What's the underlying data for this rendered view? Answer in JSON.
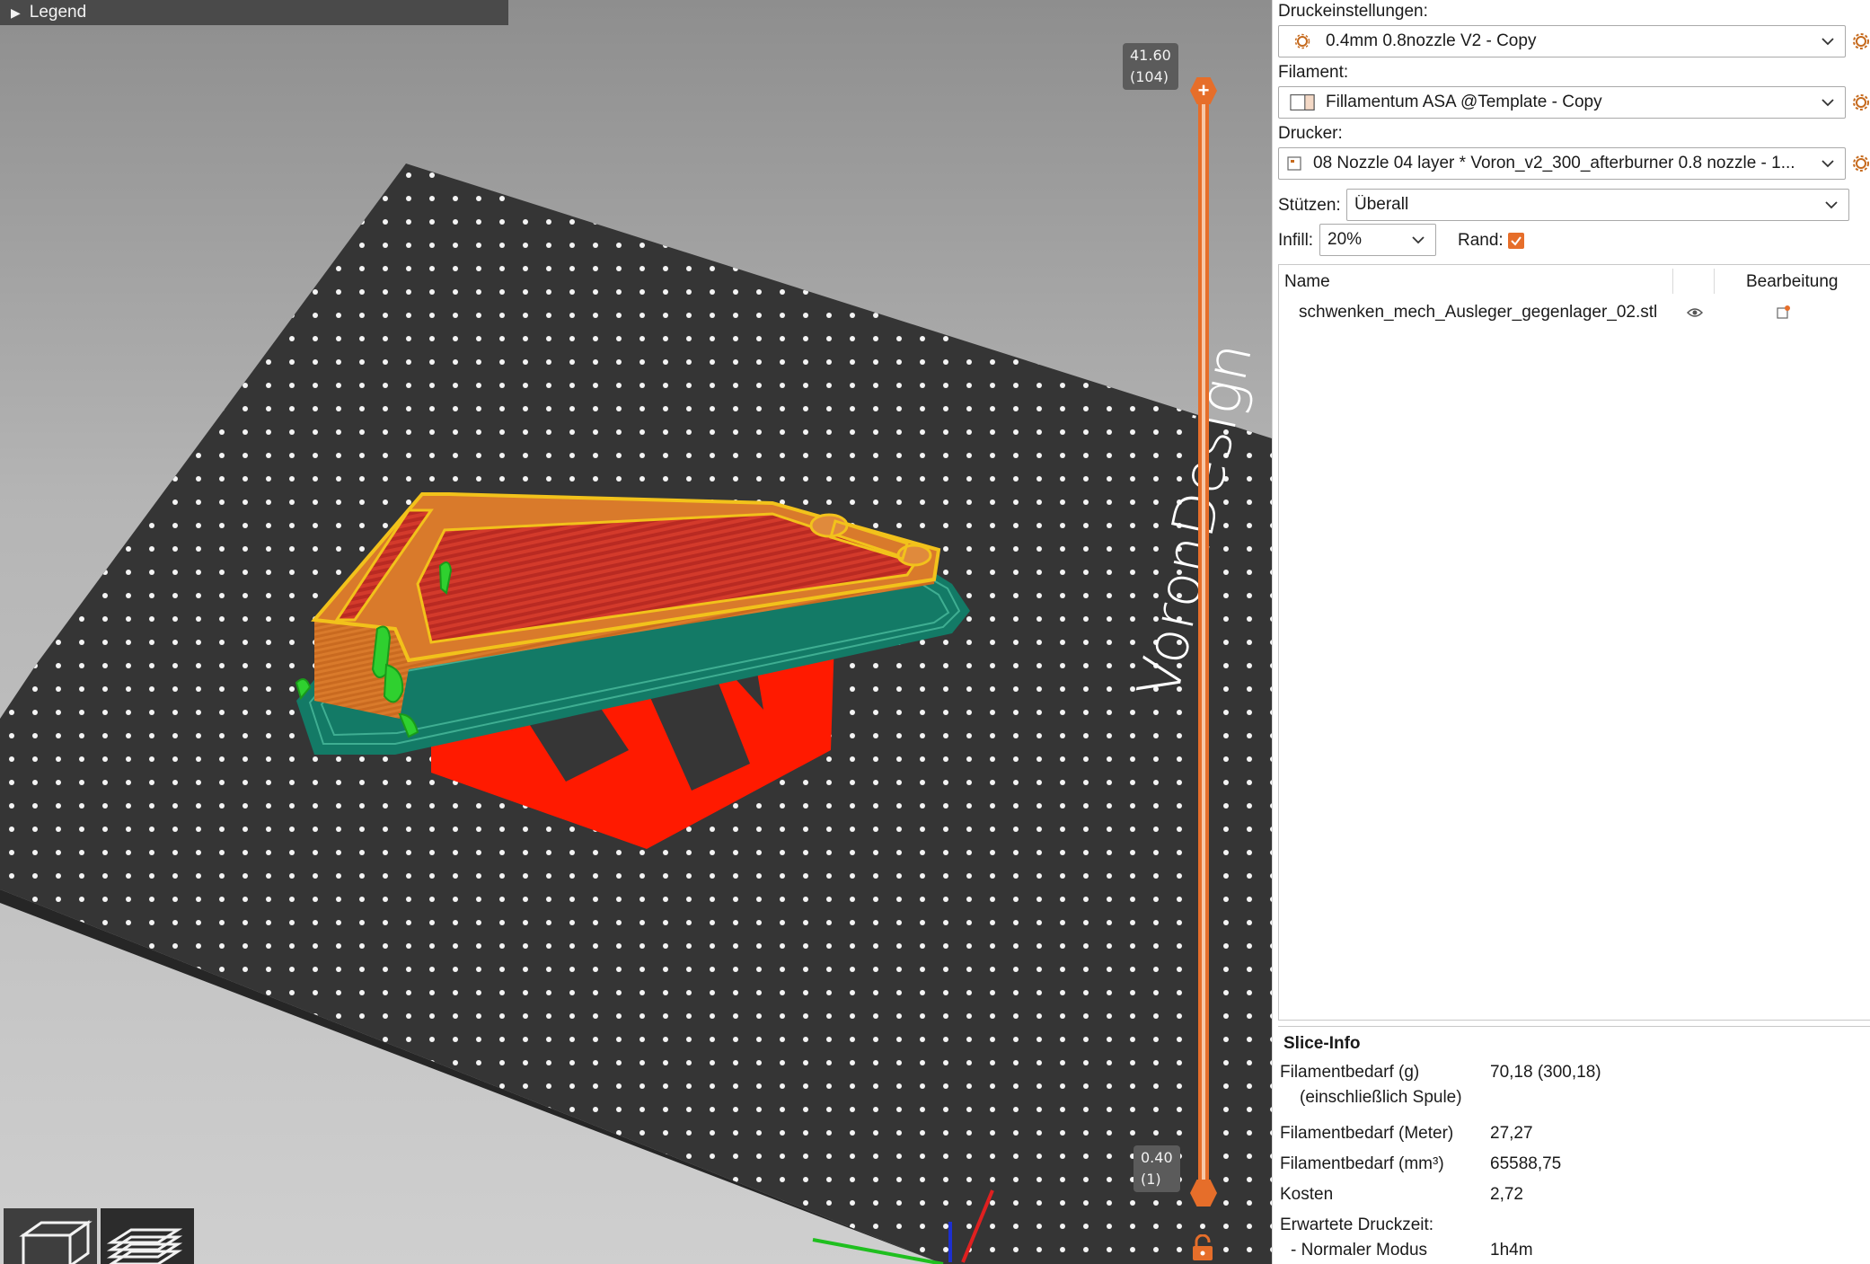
{
  "viewport": {
    "legend_label": "Legend",
    "bed_logo_text": "VoronDesign",
    "layer_slider": {
      "top_height": "41.60",
      "top_layer": "(104)",
      "bottom_height": "0.40",
      "bottom_layer": "(1)"
    },
    "colors": {
      "bed": "#353535",
      "perimeter": "#d97a2b",
      "outer_perimeter": "#f2c21b",
      "infill": "#d33a2b",
      "skirt": "#137a66",
      "support": "#2fd02f",
      "logo_red": "#ff1a00",
      "slider": "#e66e2a"
    }
  },
  "panel": {
    "print_settings": {
      "label": "Druckeinstellungen:",
      "value": "0.4mm 0.8nozzle V2 - Copy"
    },
    "filament": {
      "label": "Filament:",
      "value": "Fillamentum ASA @Template - Copy"
    },
    "printer": {
      "label": "Drucker:",
      "value": "08 Nozzle 04 layer * Voron_v2_300_afterburner 0.8 nozzle - 1..."
    },
    "supports": {
      "label": "Stützen:",
      "value": "Überall"
    },
    "infill": {
      "label": "Infill:",
      "value": "20%"
    },
    "brim": {
      "label": "Rand:",
      "checked": true
    },
    "object_list": {
      "col_name": "Name",
      "col_edit": "Bearbeitung",
      "objects": [
        {
          "name": "schwenken_mech_Ausleger_gegenlager_02.stl"
        }
      ]
    },
    "slice_info": {
      "title": "Slice-Info",
      "rows": [
        {
          "label": "Filamentbedarf (g)",
          "value": "70,18 (300,18)"
        },
        {
          "label": "(einschließlich Spule)",
          "value": ""
        },
        {
          "label": "Filamentbedarf (Meter)",
          "value": "27,27"
        },
        {
          "label": "Filamentbedarf (mm³)",
          "value": "65588,75"
        },
        {
          "label": "Kosten",
          "value": "2,72"
        },
        {
          "label": "Erwartete Druckzeit:",
          "value": ""
        },
        {
          "label": "- Normaler Modus",
          "value": "1h4m"
        }
      ]
    }
  }
}
